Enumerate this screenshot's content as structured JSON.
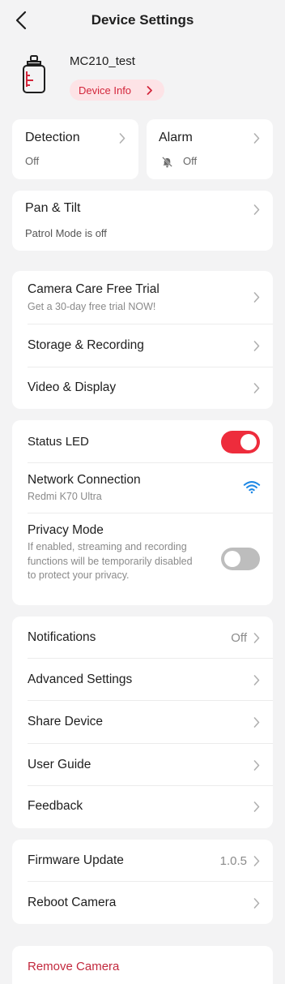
{
  "header": {
    "title": "Device Settings"
  },
  "device": {
    "name": "MC210_test",
    "info_label": "Device Info"
  },
  "detection": {
    "title": "Detection",
    "status": "Off"
  },
  "alarm": {
    "title": "Alarm",
    "status": "Off"
  },
  "pan_tilt": {
    "title": "Pan & Tilt",
    "status": "Patrol Mode is off"
  },
  "group1": {
    "camera_care": {
      "title": "Camera Care Free Trial",
      "subtitle": "Get a 30-day free trial NOW!"
    },
    "storage": "Storage & Recording",
    "video": "Video & Display"
  },
  "group2": {
    "status_led": {
      "label": "Status LED",
      "enabled": true
    },
    "network": {
      "label": "Network Connection",
      "ssid": "Redmi K70 Ultra"
    },
    "privacy": {
      "label": "Privacy Mode",
      "description": "If enabled, streaming and recording functions will be temporarily disabled to protect your privacy.",
      "enabled": false
    }
  },
  "group3": {
    "notifications": {
      "label": "Notifications",
      "value": "Off"
    },
    "advanced": "Advanced Settings",
    "share": "Share Device",
    "guide": "User Guide",
    "feedback": "Feedback"
  },
  "group4": {
    "firmware": {
      "label": "Firmware Update",
      "value": "1.0.5"
    },
    "reboot": "Reboot Camera"
  },
  "remove": "Remove Camera",
  "colors": {
    "accent": "#ee2c3c",
    "info_bg": "#fde3e6",
    "wifi": "#1e88e5",
    "remove_text": "#c2283d"
  }
}
